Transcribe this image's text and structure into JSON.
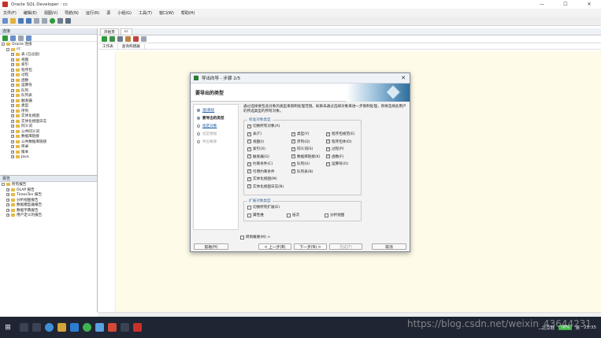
{
  "window": {
    "title": "Oracle SQL Developer : cc",
    "controls": [
      "—",
      "☐",
      "✕"
    ]
  },
  "menu": [
    "文件(F)",
    "编辑(E)",
    "视图(V)",
    "导航(N)",
    "运行(R)",
    "源",
    "小组(G)",
    "工具(T)",
    "窗口(W)",
    "帮助(H)"
  ],
  "left_panel": {
    "title": "连接",
    "tree": [
      {
        "label": "Oracle 连接",
        "level": 0,
        "expand": "-"
      },
      {
        "label": "cc",
        "level": 1,
        "expand": "-"
      },
      {
        "label": "表 (已过滤)",
        "level": 2,
        "expand": "+"
      },
      {
        "label": "视图",
        "level": 2,
        "expand": "+"
      },
      {
        "label": "索引",
        "level": 2,
        "expand": "+"
      },
      {
        "label": "程序包",
        "level": 2,
        "expand": "+"
      },
      {
        "label": "过程",
        "level": 2,
        "expand": "+"
      },
      {
        "label": "函数",
        "level": 2,
        "expand": "+"
      },
      {
        "label": "运算符",
        "level": 2,
        "expand": "+"
      },
      {
        "label": "队列",
        "level": 2,
        "expand": "+"
      },
      {
        "label": "队列表",
        "level": 2,
        "expand": "+"
      },
      {
        "label": "触发器",
        "level": 2,
        "expand": "+"
      },
      {
        "label": "类型",
        "level": 2,
        "expand": "+"
      },
      {
        "label": "序列",
        "level": 2,
        "expand": "+"
      },
      {
        "label": "实体化视图",
        "level": 2,
        "expand": "+"
      },
      {
        "label": "实体化视图日志",
        "level": 2,
        "expand": "+"
      },
      {
        "label": "同义词",
        "level": 2,
        "expand": "+"
      },
      {
        "label": "公共同义词",
        "level": 2,
        "expand": "+"
      },
      {
        "label": "数据库链接",
        "level": 2,
        "expand": "+"
      },
      {
        "label": "公共数据库链接",
        "level": 2,
        "expand": "+"
      },
      {
        "label": "目录",
        "level": 2,
        "expand": "+"
      },
      {
        "label": "版本",
        "level": 2,
        "expand": "+"
      },
      {
        "label": "Java",
        "level": 2,
        "expand": "+"
      }
    ]
  },
  "reports_panel": {
    "title": "报告",
    "tree": [
      {
        "label": "所有报告",
        "level": 0,
        "expand": "-"
      },
      {
        "label": "OLAP 报告",
        "level": 1,
        "expand": "+"
      },
      {
        "label": "TimesTen 报告",
        "level": 1,
        "expand": "+"
      },
      {
        "label": "分析视图报告",
        "level": 1,
        "expand": "+"
      },
      {
        "label": "数据模型器报告",
        "level": 1,
        "expand": "+"
      },
      {
        "label": "数据字典报告",
        "level": 1,
        "expand": "+"
      },
      {
        "label": "用户定义的报告",
        "level": 1,
        "expand": "+"
      }
    ]
  },
  "editor": {
    "tabs": [
      "开始页",
      "cc"
    ],
    "active_tab": "cc",
    "subtabs": [
      "工作表",
      "查询构建器"
    ]
  },
  "dialog": {
    "title": "导出向导 - 步骤 2/5",
    "close": "✕",
    "header": "要导出的类型",
    "steps": [
      {
        "label": "源/目标",
        "state": "link"
      },
      {
        "label": "要导出的类型",
        "state": "current"
      },
      {
        "label": "指定对象",
        "state": "link"
      },
      {
        "label": "指定数据",
        "state": "dim"
      },
      {
        "label": "导出概要",
        "state": "dim"
      }
    ],
    "description": "通过选择要包含对象的类型来限制处理范围。如果未通过选择对象来进一步限制处理，则将选择此用户的所选类型的所有对象。",
    "standard_group": {
      "title": "标准对象类型",
      "toggle_all": {
        "label": "切换所有对象(A)",
        "checked": true
      },
      "items": [
        {
          "label": "表(T)",
          "checked": true,
          "col": 0,
          "row": 0
        },
        {
          "label": "视图(I)",
          "checked": true,
          "col": 0,
          "row": 1
        },
        {
          "label": "索引(X)",
          "checked": true,
          "col": 0,
          "row": 2
        },
        {
          "label": "触发器(G)",
          "checked": true,
          "col": 0,
          "row": 3
        },
        {
          "label": "约束条件(C)",
          "checked": true,
          "col": 0,
          "row": 4
        },
        {
          "label": "引用约束条件",
          "checked": true,
          "col": 0,
          "row": 5
        },
        {
          "label": "实体化视图(M)",
          "checked": true,
          "col": 0,
          "row": 6
        },
        {
          "label": "实体化视图日志(N)",
          "checked": true,
          "col": 0,
          "row": 7
        },
        {
          "label": "类型(Y)",
          "checked": true,
          "col": 1,
          "row": 0
        },
        {
          "label": "序列(Q)",
          "checked": true,
          "col": 1,
          "row": 1
        },
        {
          "label": "同义词(S)",
          "checked": true,
          "col": 1,
          "row": 2
        },
        {
          "label": "数据库链接(K)",
          "checked": true,
          "col": 1,
          "row": 3
        },
        {
          "label": "队列(U)",
          "checked": true,
          "col": 1,
          "row": 4
        },
        {
          "label": "队列表(B)",
          "checked": true,
          "col": 1,
          "row": 5
        },
        {
          "label": "程序包规范(E)",
          "checked": true,
          "col": 2,
          "row": 0
        },
        {
          "label": "程序包体(D)",
          "checked": true,
          "col": 2,
          "row": 1
        },
        {
          "label": "过程(P)",
          "checked": true,
          "col": 2,
          "row": 2
        },
        {
          "label": "函数(F)",
          "checked": true,
          "col": 2,
          "row": 3
        },
        {
          "label": "运算符(O)",
          "checked": true,
          "col": 2,
          "row": 4
        }
      ]
    },
    "extended_group": {
      "title": "扩展对象类型",
      "toggle_all": {
        "label": "切换所有扩展(E)",
        "checked": false
      },
      "items": [
        {
          "label": "属性维",
          "checked": false
        },
        {
          "label": "层次",
          "checked": false
        },
        {
          "label": "分析视图",
          "checked": false
        }
      ]
    },
    "goto_summary": {
      "label": "转到概要(M) >",
      "checked": false
    },
    "buttons": {
      "help": "帮助(H)",
      "back": "< 上一步(B)",
      "next": "下一步(N) >",
      "finish": "完成(F)",
      "cancel": "取消"
    }
  },
  "taskbar": {
    "start": "⊞",
    "tray_text": "北京联",
    "battery": "76%",
    "time": "21:35",
    "lang": "英"
  },
  "watermark": "https://blog.csdn.net/weixin_43644231",
  "colors": {
    "accent_blue": "#1c5aa6",
    "taskbar": "#1f2532",
    "editor_bg": "#fffbe9"
  }
}
